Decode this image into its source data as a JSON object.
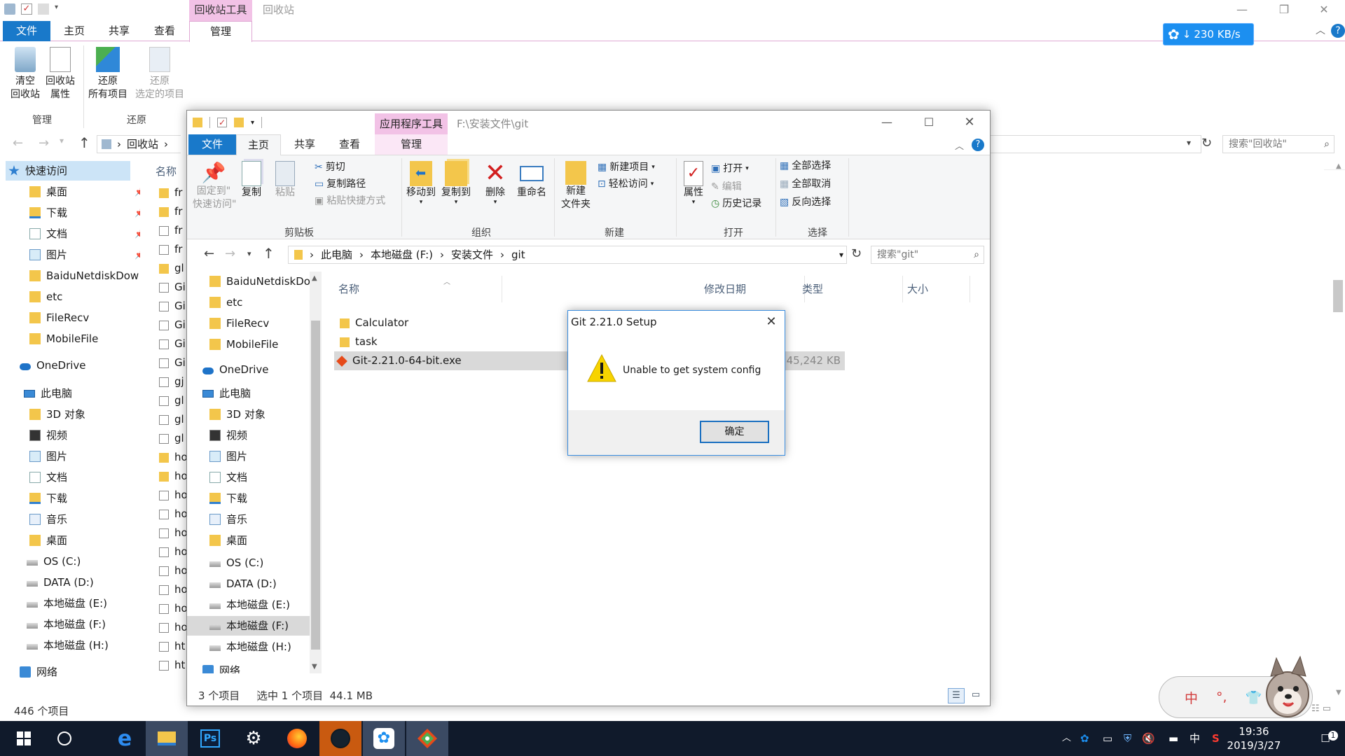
{
  "bg_window": {
    "context_tab": "回收站工具",
    "title": "回收站",
    "tabs": [
      "文件",
      "主页",
      "共享",
      "查看",
      "管理"
    ],
    "ribbon": {
      "empty_bin": "清空\n回收站",
      "bin_props": "回收站\n属性",
      "restore_all": "还原\n所有项目",
      "restore_selected": "还原\n选定的项目",
      "group_manage": "管理",
      "group_restore": "还原"
    },
    "breadcrumb": "回收站",
    "search_placeholder": "搜索\"回收站\"",
    "speed": "230 KB/s",
    "column_name": "名称",
    "nav": [
      {
        "label": "快速访问",
        "icon": "star-icon",
        "pinned": false
      },
      {
        "label": "桌面",
        "icon": "folder-icon",
        "pinned": true
      },
      {
        "label": "下载",
        "icon": "download-icon",
        "pinned": true
      },
      {
        "label": "文档",
        "icon": "document-icon",
        "pinned": true
      },
      {
        "label": "图片",
        "icon": "picture-icon",
        "pinned": true
      },
      {
        "label": "BaiduNetdiskDow",
        "icon": "folder-icon",
        "pinned": false
      },
      {
        "label": "etc",
        "icon": "folder-icon",
        "pinned": false
      },
      {
        "label": "FileRecv",
        "icon": "folder-icon",
        "pinned": false
      },
      {
        "label": "MobileFile",
        "icon": "folder-icon",
        "pinned": false
      },
      {
        "label": "OneDrive",
        "icon": "cloud-icon",
        "pinned": false
      },
      {
        "label": "此电脑",
        "icon": "pc-icon",
        "pinned": false
      },
      {
        "label": "3D 对象",
        "icon": "folder-icon",
        "pinned": false
      },
      {
        "label": "视频",
        "icon": "video-icon",
        "pinned": false
      },
      {
        "label": "图片",
        "icon": "picture-icon",
        "pinned": false
      },
      {
        "label": "文档",
        "icon": "document-icon",
        "pinned": false
      },
      {
        "label": "下载",
        "icon": "download-icon",
        "pinned": false
      },
      {
        "label": "音乐",
        "icon": "music-icon",
        "pinned": false
      },
      {
        "label": "桌面",
        "icon": "folder-icon",
        "pinned": false
      },
      {
        "label": "OS (C:)",
        "icon": "drive-icon",
        "pinned": false
      },
      {
        "label": "DATA (D:)",
        "icon": "drive-icon",
        "pinned": false
      },
      {
        "label": "本地磁盘 (E:)",
        "icon": "drive-icon",
        "pinned": false
      },
      {
        "label": "本地磁盘 (F:)",
        "icon": "drive-icon",
        "pinned": false
      },
      {
        "label": "本地磁盘 (H:)",
        "icon": "drive-icon",
        "pinned": false
      },
      {
        "label": "网络",
        "icon": "network-icon",
        "pinned": false
      }
    ],
    "files_truncated": [
      "fr",
      "fr",
      "fr",
      "fr",
      "gl",
      "Gi",
      "Gi",
      "Gi",
      "Gi",
      "Gi",
      "gj",
      "gl",
      "gl",
      "gl",
      "ho",
      "ho",
      "ho",
      "ho",
      "ho",
      "ho",
      "ho",
      "ho",
      "ho",
      "ho",
      "ht",
      "ht"
    ],
    "status": "446 个项目"
  },
  "fg_window": {
    "context_tab": "应用程序工具",
    "path_title": "F:\\安装文件\\git",
    "tabs": [
      "文件",
      "主页",
      "共享",
      "查看",
      "管理"
    ],
    "ribbon": {
      "pin": "固定到\"\n快速访问\"",
      "copy": "复制",
      "paste": "粘贴",
      "cut": "剪切",
      "copy_path": "复制路径",
      "paste_shortcut": "粘贴快捷方式",
      "group_clipboard": "剪贴板",
      "move_to": "移动到",
      "copy_to": "复制到",
      "delete": "删除",
      "rename": "重命名",
      "group_organize": "组织",
      "new_folder": "新建\n文件夹",
      "new_item": "新建项目",
      "easy_access": "轻松访问",
      "group_new": "新建",
      "properties": "属性",
      "open": "打开",
      "edit": "编辑",
      "history": "历史记录",
      "group_open": "打开",
      "select_all": "全部选择",
      "select_none": "全部取消",
      "invert_select": "反向选择",
      "group_select": "选择"
    },
    "breadcrumb": [
      "此电脑",
      "本地磁盘 (F:)",
      "安装文件",
      "git"
    ],
    "search_placeholder": "搜索\"git\"",
    "columns": [
      "名称",
      "修改日期",
      "类型",
      "大小"
    ],
    "files": [
      {
        "name": "Calculator",
        "icon": "folder-icon",
        "size": ""
      },
      {
        "name": "task",
        "icon": "folder-icon",
        "size": ""
      },
      {
        "name": "Git-2.21.0-64-bit.exe",
        "icon": "git-icon",
        "size": "45,242 KB"
      }
    ],
    "nav": [
      {
        "label": "BaiduNetdiskDo",
        "icon": "folder-icon"
      },
      {
        "label": "etc",
        "icon": "folder-icon"
      },
      {
        "label": "FileRecv",
        "icon": "folder-icon"
      },
      {
        "label": "MobileFile",
        "icon": "folder-icon"
      },
      {
        "label": "OneDrive",
        "icon": "cloud-icon"
      },
      {
        "label": "此电脑",
        "icon": "pc-icon"
      },
      {
        "label": "3D 对象",
        "icon": "folder-icon"
      },
      {
        "label": "视频",
        "icon": "video-icon"
      },
      {
        "label": "图片",
        "icon": "picture-icon"
      },
      {
        "label": "文档",
        "icon": "document-icon"
      },
      {
        "label": "下载",
        "icon": "download-icon"
      },
      {
        "label": "音乐",
        "icon": "music-icon"
      },
      {
        "label": "桌面",
        "icon": "folder-icon"
      },
      {
        "label": "OS (C:)",
        "icon": "drive-icon"
      },
      {
        "label": "DATA (D:)",
        "icon": "drive-icon"
      },
      {
        "label": "本地磁盘 (E:)",
        "icon": "drive-icon"
      },
      {
        "label": "本地磁盘 (F:)",
        "icon": "drive-icon"
      },
      {
        "label": "本地磁盘 (H:)",
        "icon": "drive-icon"
      },
      {
        "label": "网络",
        "icon": "network-icon"
      }
    ],
    "status_count": "3 个项目",
    "status_selected": "选中 1 个项目  44.1 MB"
  },
  "dialog": {
    "title": "Git 2.21.0 Setup",
    "message": "Unable to get system config",
    "ok": "确定"
  },
  "ime": {
    "lang": "中",
    "punct": "°,",
    "skin": "👕"
  },
  "taskbar": {
    "tray_lang": "中",
    "time": "19:36",
    "date": "2019/3/27",
    "notification_count": "1"
  },
  "colors": {
    "accent": "#1979ca",
    "context_tab": "#f2c2e6",
    "taskbar": "#101a2b",
    "selection": "#cce4f7"
  }
}
